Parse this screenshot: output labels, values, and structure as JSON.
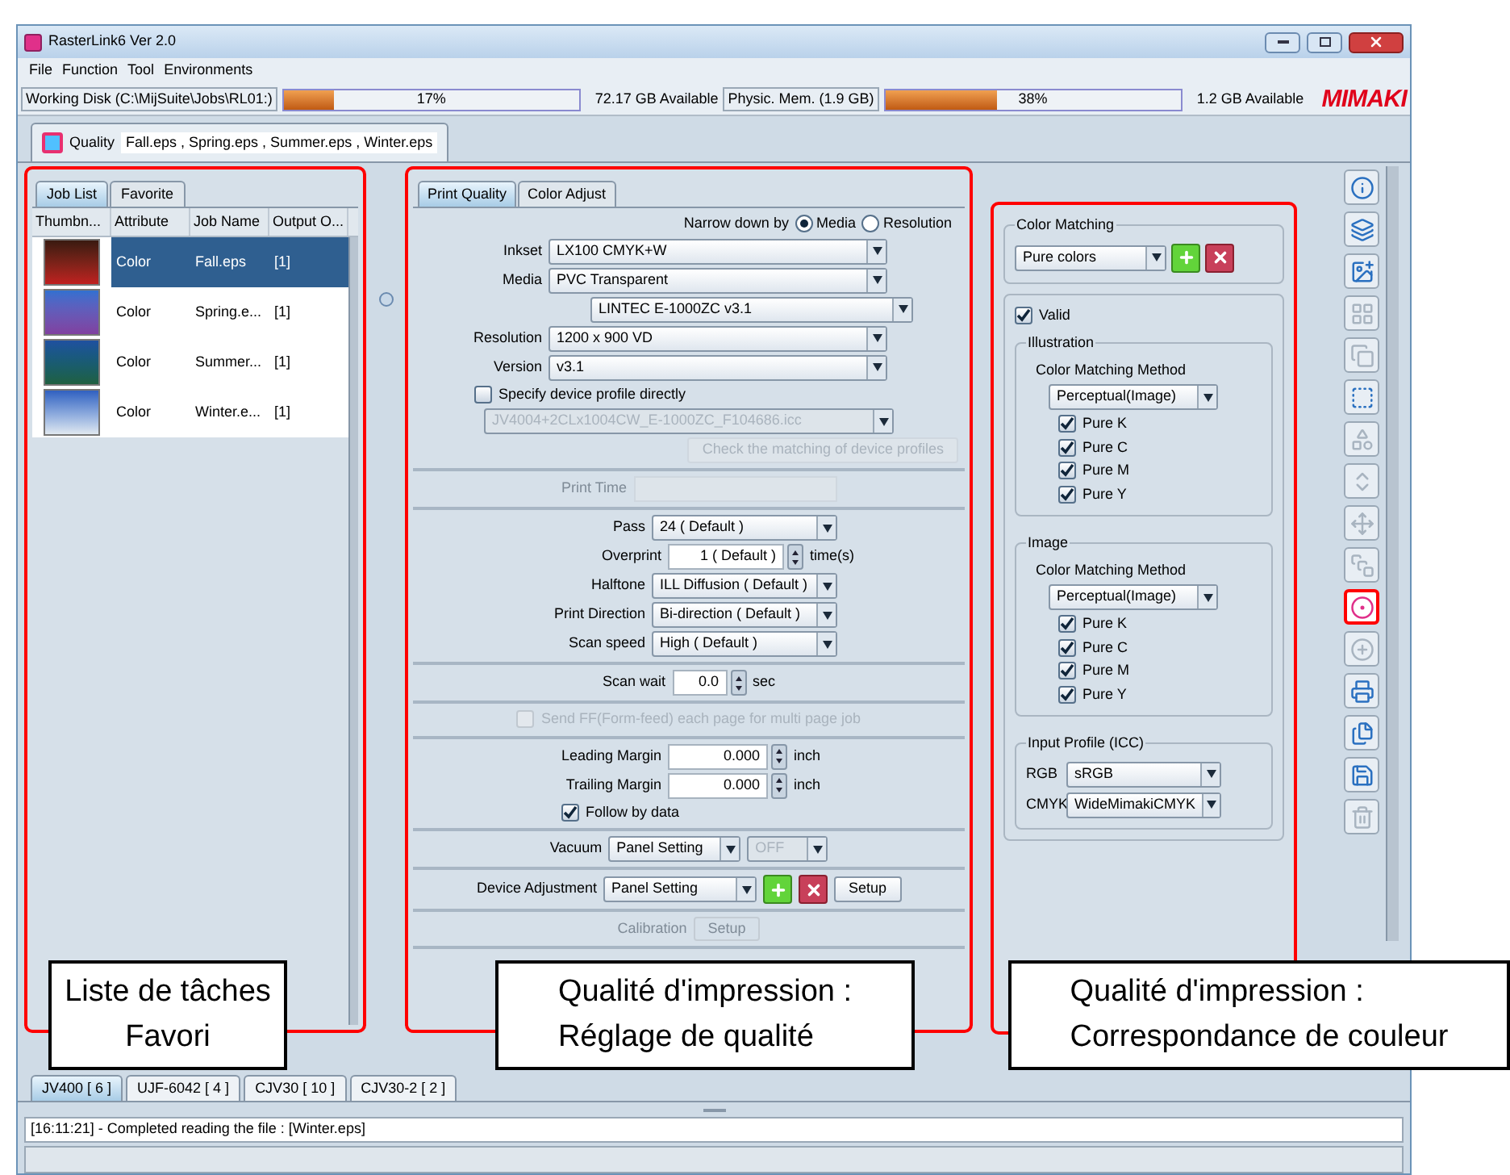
{
  "window": {
    "title": "RasterLink6 Ver 2.0"
  },
  "menu": [
    "File",
    "Function",
    "Tool",
    "Environments"
  ],
  "status": {
    "disk": {
      "label": "Working Disk (C:\\MijSuite\\Jobs\\RL01:)",
      "level": 0.17,
      "percent": "17%",
      "available": "72.17 GB Available"
    },
    "memory": {
      "label": "Physic. Mem. (1.9 GB)",
      "level": 0.38,
      "percent": "38%",
      "available": "1.2 GB Available"
    },
    "logo": "MIMAKI"
  },
  "function_tab": {
    "label": "Quality",
    "files": "Fall.eps , Spring.eps , Summer.eps , Winter.eps"
  },
  "job_panel": {
    "tabs": [
      {
        "label": "Job List",
        "selected": true
      },
      {
        "label": "Favorite",
        "selected": false
      }
    ],
    "columns": [
      "Thumbn...",
      "Attribute",
      "Job Name",
      "Output O..."
    ],
    "rows": [
      {
        "attribute": "Color",
        "job_name": "Fall.eps",
        "output": "[1]",
        "selected": true
      },
      {
        "attribute": "Color",
        "job_name": "Spring.e...",
        "output": "[1]",
        "selected": false
      },
      {
        "attribute": "Color",
        "job_name": "Summer...",
        "output": "[1]",
        "selected": false
      },
      {
        "attribute": "Color",
        "job_name": "Winter.e...",
        "output": "[1]",
        "selected": false
      }
    ]
  },
  "print_quality": {
    "tabs": [
      {
        "label": "Print Quality",
        "selected": true
      },
      {
        "label": "Color Adjust",
        "selected": false
      }
    ],
    "sections": [
      {
        "rows": [
          {
            "kind": "radio",
            "label": "Narrow down by",
            "options": [
              {
                "label": "Media",
                "selected": true
              },
              {
                "label": "Resolution",
                "selected": false
              }
            ]
          },
          {
            "kind": "select",
            "label": "Inkset",
            "value": "LX100 CMYK+W"
          },
          {
            "kind": "select",
            "label": "Media",
            "value": "PVC Transparent"
          },
          {
            "kind": "subselect",
            "value": "LINTEC E-1000ZC v3.1"
          },
          {
            "kind": "select",
            "label": "Resolution",
            "value": "1200 x 900 VD"
          },
          {
            "kind": "select",
            "label": "Version",
            "value": "v3.1"
          },
          {
            "kind": "checkbox",
            "label": "Specify device profile directly",
            "checked": false,
            "disabled": false
          },
          {
            "kind": "select",
            "value": "JV4004+2CLx1004CW_E-1000ZC_F104686.icc",
            "disabled": true
          },
          {
            "kind": "button",
            "label": "Check the matching of device profiles",
            "disabled": true
          }
        ]
      },
      {
        "rows": [
          {
            "kind": "textfield",
            "label": "Print Time",
            "disabled": true
          }
        ]
      },
      {
        "rows": [
          {
            "kind": "select",
            "label": "Pass",
            "value": "24 ( Default )"
          },
          {
            "kind": "spinner",
            "label": "Overprint",
            "value": "1 ( Default )",
            "unit": "time(s)"
          },
          {
            "kind": "select",
            "label": "Halftone",
            "value": "ILL Diffusion ( Default )"
          },
          {
            "kind": "select",
            "label": "Print Direction",
            "value": "Bi-direction ( Default )"
          },
          {
            "kind": "select",
            "label": "Scan speed",
            "value": "High ( Default )"
          }
        ]
      },
      {
        "rows": [
          {
            "kind": "spinner",
            "label": "Scan wait",
            "value": "0.0",
            "unit": "sec"
          }
        ]
      },
      {
        "rows": [
          {
            "kind": "checkbox",
            "label": "Send FF(Form-feed) each page for multi page job",
            "checked": false,
            "disabled": true
          }
        ]
      },
      {
        "rows": [
          {
            "kind": "spinner",
            "label": "Leading Margin",
            "value": "0.000",
            "unit": "inch"
          },
          {
            "kind": "spinner",
            "label": "Trailing Margin",
            "value": "0.000",
            "unit": "inch"
          },
          {
            "kind": "checkbox",
            "label": "Follow by data",
            "checked": true,
            "disabled": false
          }
        ]
      },
      {
        "rows": [
          {
            "kind": "selectpair",
            "label": "Vacuum",
            "value": "Panel Setting",
            "value2": "OFF"
          }
        ]
      },
      {
        "rows": [
          {
            "kind": "device",
            "label": "Device Adjustment",
            "value": "Panel Setting",
            "button": "Setup"
          }
        ]
      },
      {
        "rows": [
          {
            "kind": "labelbutton",
            "label": "Calibration",
            "button": "Setup",
            "disabled": true
          }
        ]
      }
    ]
  },
  "color_matching": {
    "title": "Color Matching",
    "value": "Pure colors",
    "valid": {
      "label": "Valid",
      "checked": true
    },
    "groups": [
      {
        "title": "Illustration",
        "method_label": "Color Matching Method",
        "method": "Perceptual(Image)",
        "options": [
          {
            "label": "Pure K",
            "checked": true
          },
          {
            "label": "Pure C",
            "checked": true
          },
          {
            "label": "Pure M",
            "checked": true
          },
          {
            "label": "Pure Y",
            "checked": true
          }
        ]
      },
      {
        "title": "Image",
        "method_label": "Color Matching Method",
        "method": "Perceptual(Image)",
        "options": [
          {
            "label": "Pure K",
            "checked": true
          },
          {
            "label": "Pure C",
            "checked": true
          },
          {
            "label": "Pure M",
            "checked": true
          },
          {
            "label": "Pure Y",
            "checked": true
          }
        ]
      }
    ],
    "input_profile": {
      "title": "Input Profile (ICC)",
      "rows": [
        {
          "label": "RGB",
          "value": "sRGB"
        },
        {
          "label": "CMYK",
          "value": "WideMimakiCMYK"
        }
      ]
    }
  },
  "toolbar": [
    {
      "selected": false,
      "disabled": false
    },
    {
      "selected": false,
      "disabled": false
    },
    {
      "selected": false,
      "disabled": false
    },
    {
      "selected": false,
      "disabled": true
    },
    {
      "selected": false,
      "disabled": true
    },
    {
      "selected": false,
      "disabled": false
    },
    {
      "selected": false,
      "disabled": true
    },
    {
      "selected": false,
      "disabled": true
    },
    {
      "selected": false,
      "disabled": true
    },
    {
      "selected": false,
      "disabled": true
    },
    {
      "selected": true,
      "disabled": false
    },
    {
      "selected": false,
      "disabled": true
    },
    {
      "selected": false,
      "disabled": false
    },
    {
      "selected": false,
      "disabled": false
    },
    {
      "selected": false,
      "disabled": false
    },
    {
      "selected": false,
      "disabled": true
    }
  ],
  "printer_tabs": [
    {
      "label": "JV400 [ 6 ]",
      "selected": true
    },
    {
      "label": "UJF-6042 [ 4 ]",
      "selected": false
    },
    {
      "label": "CJV30 [ 10 ]",
      "selected": false
    },
    {
      "label": "CJV30-2 [ 2 ]",
      "selected": false
    }
  ],
  "log": "[16:11:21] - Completed reading the file : [Winter.eps]",
  "callouts": [
    "Liste de tâches\nFavori",
    "Qualité d'impression :\nRéglage de qualité",
    "Qualité d'impression :\nCorrespondance de couleur"
  ]
}
